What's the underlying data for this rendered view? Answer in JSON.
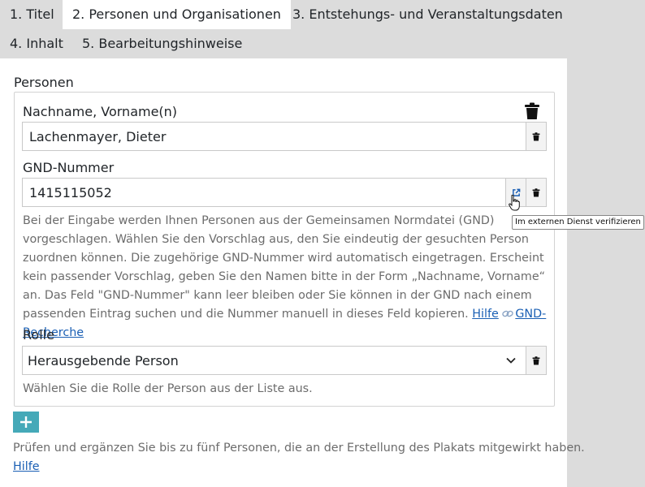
{
  "tabs": [
    {
      "label": "1. Titel"
    },
    {
      "label": "2. Personen und Organisationen"
    },
    {
      "label": "3. Entstehungs- und Veranstaltungsdaten"
    },
    {
      "label": "4. Inhalt"
    },
    {
      "label": "5. Bearbeitungshinweise"
    }
  ],
  "active_tab": "2. Personen und Organisationen",
  "section": {
    "title": "Personen"
  },
  "person": {
    "name_label": "Nachname, Vorname(n)",
    "name_value": "Lachenmayer, Dieter",
    "gnd_label": "GND-Nummer",
    "gnd_value": "1415115052",
    "gnd_help": "Bei der Eingabe werden Ihnen Personen aus der Gemeinsamen Normdatei (GND) vorgeschlagen. Wählen Sie den Vorschlag aus, den Sie eindeutig der gesuchten Person zuordnen können. Die zugehörige GND-Nummer wird automatisch eingetragen. Erscheint kein passender Vorschlag, geben Sie den Namen bitte in der Form „Nachname, Vorname“ an. Das Feld \"GND-Nummer\" kann leer bleiben oder Sie können in der GND nach einem passenden Eintrag suchen und die Nummer manuell in dieses Feld kopieren.",
    "gnd_help_link": "Hilfe",
    "gnd_research_link": "GND-Recherche",
    "role_label": "Rolle",
    "role_value": "Herausgebende Person",
    "role_help": "Wählen Sie die Rolle der Person aus der Liste aus."
  },
  "tooltip": {
    "verify": "Im externen Dienst verifizieren"
  },
  "bottom": {
    "help_text": "Prüfen und ergänzen Sie bis zu fünf Personen, die an der Erstellung des Plakats mitgewirkt haben.",
    "help_link": "Hilfe"
  },
  "colors": {
    "accent": "#45a9b8",
    "link": "#1a5fb4",
    "muted_text": "#6c6c6c",
    "page_bg": "#dcdcdc"
  },
  "icons": [
    "trash-icon",
    "external-link-icon",
    "chain-link-icon",
    "chevron-down-icon",
    "plus-icon",
    "pointer-cursor-icon"
  ]
}
